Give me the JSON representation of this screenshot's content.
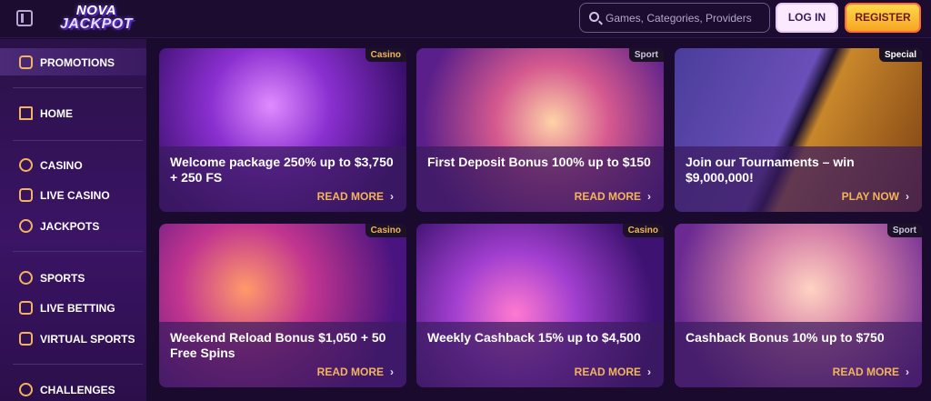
{
  "header": {
    "logo_line1": "NOVA",
    "logo_line2": "JACKPOT",
    "search_placeholder": "Games, Categories, Providers",
    "login_label": "LOG IN",
    "register_label": "REGISTER"
  },
  "sidebar": {
    "items": [
      {
        "label": "PROMOTIONS",
        "icon": "gift-box-icon"
      },
      {
        "label": "HOME",
        "icon": "home-icon"
      },
      {
        "label": "CASINO",
        "icon": "casino-chip-icon"
      },
      {
        "label": "LIVE CASINO",
        "icon": "spade-icon"
      },
      {
        "label": "JACKPOTS",
        "icon": "seven-icon"
      },
      {
        "label": "SPORTS",
        "icon": "soccer-ball-icon"
      },
      {
        "label": "LIVE BETTING",
        "icon": "play-icon"
      },
      {
        "label": "VIRTUAL SPORTS",
        "icon": "gamepad-icon"
      },
      {
        "label": "CHALLENGES",
        "icon": "medal-icon"
      }
    ]
  },
  "promotions": [
    {
      "tag": "Casino",
      "title": "Welcome package 250% up to $3,750 + 250 FS",
      "cta": "READ MORE"
    },
    {
      "tag": "Sport",
      "title": "First Deposit Bonus 100% up to $150",
      "cta": "READ MORE"
    },
    {
      "tag": "Special",
      "title": "Join our Tournaments – win $9,000,000!",
      "cta": "PLAY NOW"
    },
    {
      "tag": "Casino",
      "title": "Weekend Reload Bonus $1,050 + 50 Free Spins",
      "cta": "READ MORE"
    },
    {
      "tag": "Casino",
      "title": "Weekly Cashback 15% up to $4,500",
      "cta": "READ MORE"
    },
    {
      "tag": "Sport",
      "title": "Cashback Bonus 10% up to $750",
      "cta": "READ MORE"
    }
  ],
  "colors": {
    "accent": "#f3b45b",
    "background": "#1a0b2e",
    "register": "#ffd84a"
  }
}
